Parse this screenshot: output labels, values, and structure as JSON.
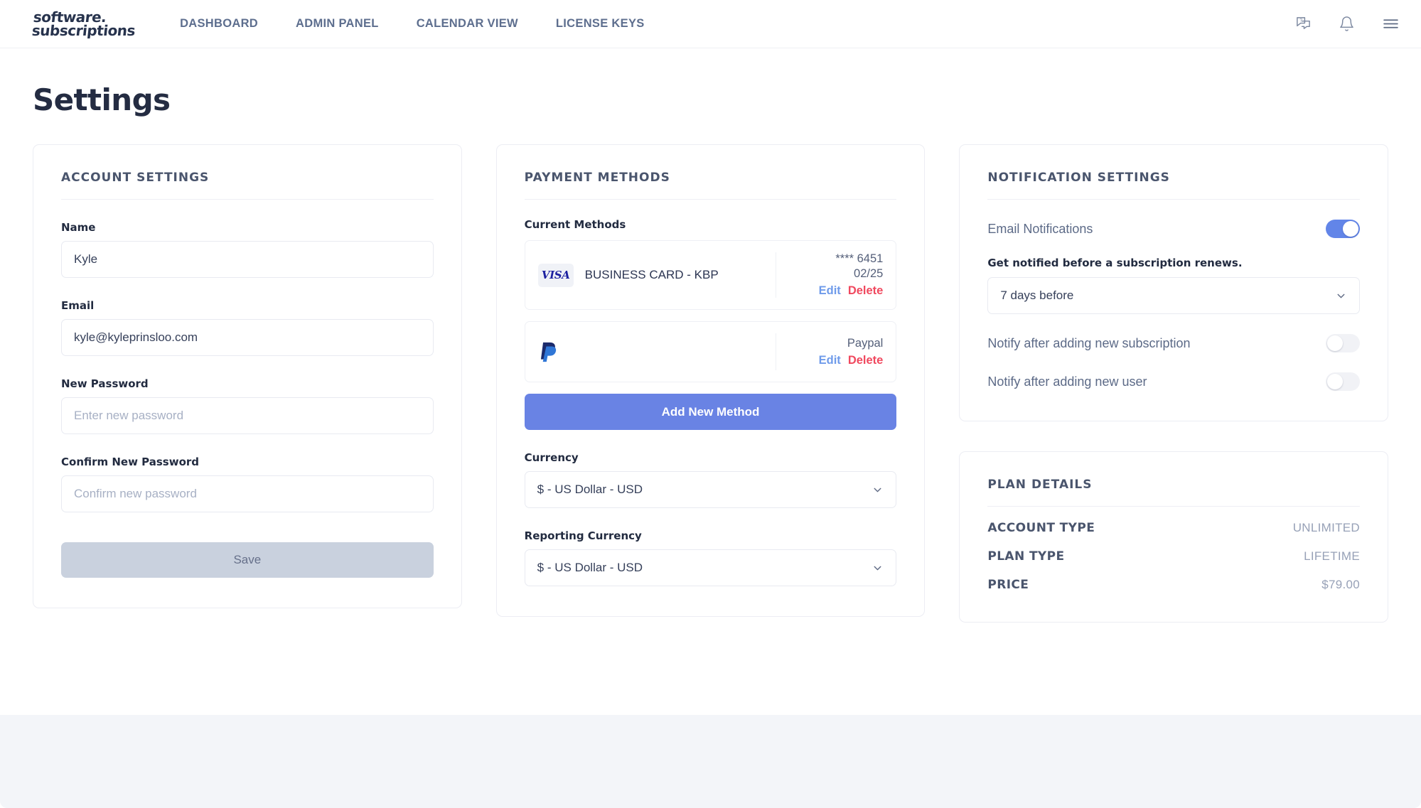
{
  "header": {
    "logo_line1": "software.",
    "logo_line2": "subscriptions",
    "nav": [
      {
        "label": "DASHBOARD"
      },
      {
        "label": "ADMIN PANEL"
      },
      {
        "label": "CALENDAR VIEW"
      },
      {
        "label": "LICENSE KEYS"
      }
    ],
    "icons": [
      {
        "name": "help-chat-icon"
      },
      {
        "name": "bell-icon"
      },
      {
        "name": "hamburger-menu-icon"
      }
    ]
  },
  "page": {
    "title": "Settings"
  },
  "account_settings": {
    "title": "ACCOUNT SETTINGS",
    "name_label": "Name",
    "name_value": "Kyle",
    "email_label": "Email",
    "email_value": "kyle@kyleprinsloo.com",
    "new_password_label": "New Password",
    "new_password_placeholder": "Enter new password",
    "new_password_value": "",
    "confirm_password_label": "Confirm New Password",
    "confirm_password_placeholder": "Confirm new password",
    "confirm_password_value": "",
    "save_label": "Save"
  },
  "payment_methods": {
    "title": "PAYMENT METHODS",
    "current_methods_label": "Current Methods",
    "methods": [
      {
        "brand": "VISA",
        "brand_icon": "visa-logo",
        "name": "BUSINESS CARD - KBP",
        "number": "**** 6451",
        "expiry": "02/25",
        "edit_label": "Edit",
        "delete_label": "Delete"
      },
      {
        "brand": "PayPal",
        "brand_icon": "paypal-logo",
        "name": "",
        "number": "Paypal",
        "expiry": "",
        "edit_label": "Edit",
        "delete_label": "Delete"
      }
    ],
    "add_button_label": "Add New Method",
    "currency_label": "Currency",
    "currency_value": "$ - US Dollar - USD",
    "reporting_currency_label": "Reporting Currency",
    "reporting_currency_value": "$ - US Dollar - USD"
  },
  "notification_settings": {
    "title": "NOTIFICATION SETTINGS",
    "email_notifications_label": "Email Notifications",
    "email_notifications_on": true,
    "renew_notice_label": "Get notified before a subscription renews.",
    "renew_notice_value": "7 days before",
    "notify_new_subscription_label": "Notify after adding new subscription",
    "notify_new_subscription_on": false,
    "notify_new_user_label": "Notify after adding new user",
    "notify_new_user_on": false
  },
  "plan_details": {
    "title": "PLAN DETAILS",
    "rows": [
      {
        "key": "ACCOUNT TYPE",
        "value": "UNLIMITED"
      },
      {
        "key": "PLAN TYPE",
        "value": "LIFETIME"
      },
      {
        "key": "PRICE",
        "value": "$79.00"
      }
    ]
  },
  "colors": {
    "accent": "#6983e4",
    "toggle_on": "#6285e8",
    "edit_link": "#6f9bea",
    "delete_link": "#f0485e",
    "nav_text": "#5d6e8e",
    "footer_band": "#f3f5f9"
  }
}
